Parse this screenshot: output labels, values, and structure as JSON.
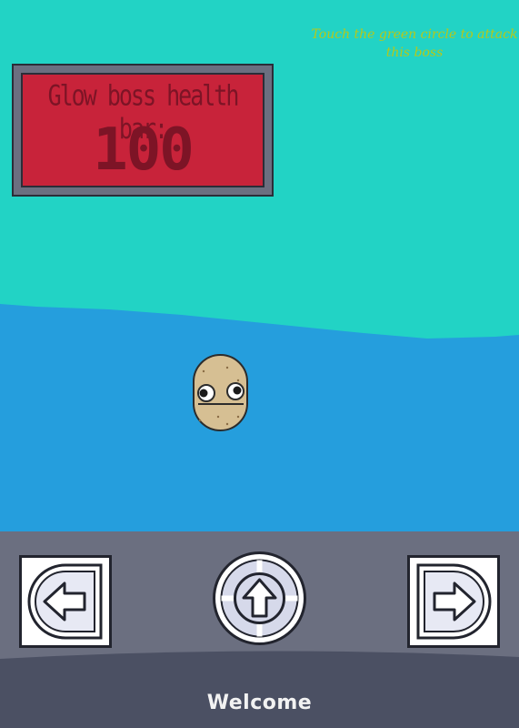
{
  "hint": {
    "text": "Touch the green circle to attack this boss"
  },
  "boss": {
    "health_label": "Glow boss health bar:",
    "health_value": "100"
  },
  "controls": {
    "left_icon": "arrow-left-icon",
    "up_icon": "arrow-up-icon",
    "right_icon": "arrow-right-icon"
  },
  "footer": {
    "welcome": "Welcome"
  },
  "colors": {
    "sky": "#22d3c5",
    "water": "#259edd",
    "panel": "#6b6f80",
    "footer": "#4b5063",
    "boss_red": "#c8233a",
    "hint_text": "#b5c91a"
  }
}
